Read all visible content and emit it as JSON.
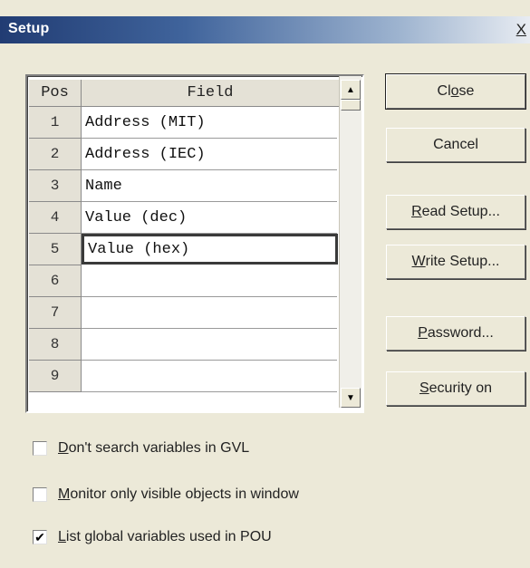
{
  "window": {
    "title": "Setup",
    "close_label": "X"
  },
  "table": {
    "headers": {
      "pos": "Pos",
      "field": "Field"
    },
    "rows": [
      {
        "pos": "1",
        "field": "Address (MIT)"
      },
      {
        "pos": "2",
        "field": "Address (IEC)"
      },
      {
        "pos": "3",
        "field": "Name"
      },
      {
        "pos": "4",
        "field": "Value (dec)"
      },
      {
        "pos": "5",
        "field": "Value (hex)"
      },
      {
        "pos": "6",
        "field": ""
      },
      {
        "pos": "7",
        "field": ""
      },
      {
        "pos": "8",
        "field": ""
      },
      {
        "pos": "9",
        "field": ""
      }
    ],
    "selected_row": 5
  },
  "buttons": {
    "close": {
      "pre": "Cl",
      "ul": "o",
      "post": "se"
    },
    "cancel": {
      "pre": "Cancel",
      "ul": "",
      "post": ""
    },
    "read_setup": {
      "pre": "",
      "ul": "R",
      "post": "ead Setup..."
    },
    "write_setup": {
      "pre": "",
      "ul": "W",
      "post": "rite Setup..."
    },
    "password": {
      "pre": "",
      "ul": "P",
      "post": "assword..."
    },
    "security_on": {
      "pre": "",
      "ul": "S",
      "post": "ecurity on"
    }
  },
  "checkboxes": [
    {
      "ul": "D",
      "rest": "on't search variables in GVL",
      "checked": false
    },
    {
      "ul": "M",
      "rest": "onitor only visible objects in window",
      "checked": false
    },
    {
      "ul": "L",
      "rest": "ist global variables used in POU",
      "checked": true
    }
  ],
  "icons": {
    "scroll_up": "triangle-up-icon",
    "scroll_down": "triangle-down-icon",
    "check": "checkmark-icon"
  }
}
